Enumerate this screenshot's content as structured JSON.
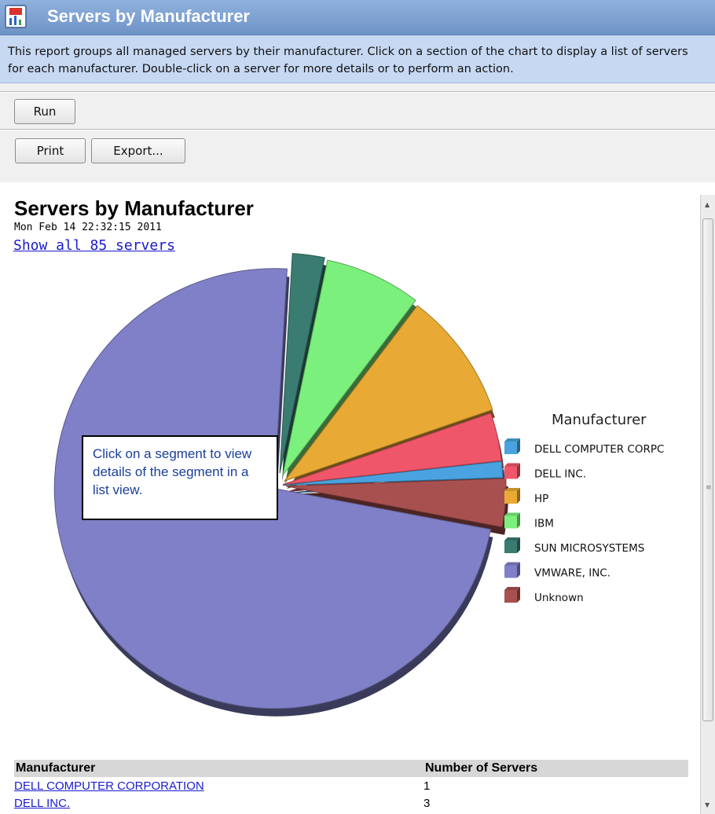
{
  "header": {
    "title": "Servers by Manufacturer",
    "colors": {
      "bar": "#7f9fd0",
      "text": "#ffffff"
    }
  },
  "description": "This report groups all managed servers by their manufacturer. Click on a section of the chart to display a list of servers for each manufacturer. Double-click on a server for more details or to perform an action.",
  "toolbar": {
    "run_label": "Run",
    "print_label": "Print",
    "export_label": "Export..."
  },
  "report": {
    "title": "Servers by Manufacturer",
    "date": "Mon Feb 14 22:32:15 2011",
    "show_all_link": "Show all 85 servers"
  },
  "callout": "Click on a segment to view details of the segment in a list view.",
  "chart_data": {
    "type": "pie",
    "title": "",
    "legend_title": "Manufacturer",
    "legend_position": "right",
    "legend_labels": [
      "DELL COMPUTER CORPC",
      "DELL INC.",
      "HP",
      "IBM",
      "SUN MICROSYSTEMS",
      "VMWARE, INC.",
      "Unknown"
    ],
    "categories": [
      "DELL COMPUTER CORPORATION",
      "DELL INC.",
      "HP",
      "IBM",
      "SUN MICROSYSTEMS",
      "VMWARE, INC.",
      "Unknown"
    ],
    "values": [
      1,
      3,
      8,
      6,
      2,
      62,
      3
    ],
    "colors": [
      "#4aa3e0",
      "#f0566a",
      "#e8aa34",
      "#7cf07c",
      "#3a7c72",
      "#8080c8",
      "#a85050"
    ],
    "exploded": true
  },
  "table": {
    "headers": [
      "Manufacturer",
      "Number of Servers"
    ],
    "rows": [
      {
        "manufacturer": "DELL COMPUTER CORPORATION",
        "count": "1"
      },
      {
        "manufacturer": "DELL INC.",
        "count": "3"
      }
    ]
  }
}
